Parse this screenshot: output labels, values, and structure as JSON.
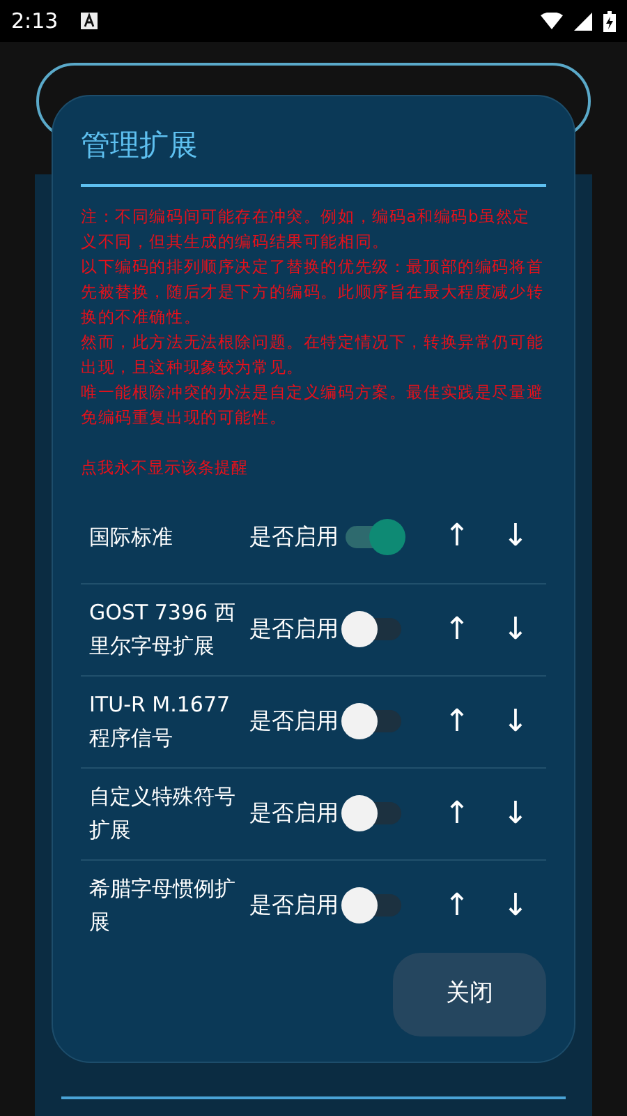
{
  "status_bar": {
    "time": "2:13"
  },
  "dialog": {
    "title": "管理扩展",
    "notes": [
      "注：不同编码间可能存在冲突。例如，编码a和编码b虽然定义不同，但其生成的编码结果可能相同。",
      "以下编码的排列顺序决定了替换的优先级：最顶部的编码将首先被替换，随后才是下方的编码。此顺序旨在最大程度减少转换的不准确性。",
      "然而，此方法无法根除问题。在特定情况下，转换异常仍可能出现，且这种现象较为常见。",
      "唯一能根除冲突的办法是自定义编码方案。最佳实践是尽量避免编码重复出现的可能性。"
    ],
    "dismiss_link": "点我永不显示该条提醒",
    "extensions": [
      {
        "name": "国际标准",
        "enable_label": "是否启用",
        "on": true,
        "up": "↑",
        "down": "↓"
      },
      {
        "name": "GOST 7396 西里尔字母扩展",
        "enable_label": "是否启用",
        "on": false,
        "up": "↑",
        "down": "↓"
      },
      {
        "name": "ITU-R M.1677 程序信号",
        "enable_label": "是否启用",
        "on": false,
        "up": "↑",
        "down": "↓"
      },
      {
        "name": "自定义特殊符号扩展",
        "enable_label": "是否启用",
        "on": false,
        "up": "↑",
        "down": "↓"
      },
      {
        "name": "希腊字母惯例扩展",
        "enable_label": "是否启用",
        "on": false,
        "up": "↑",
        "down": "↓"
      }
    ],
    "close_button": "关闭"
  }
}
